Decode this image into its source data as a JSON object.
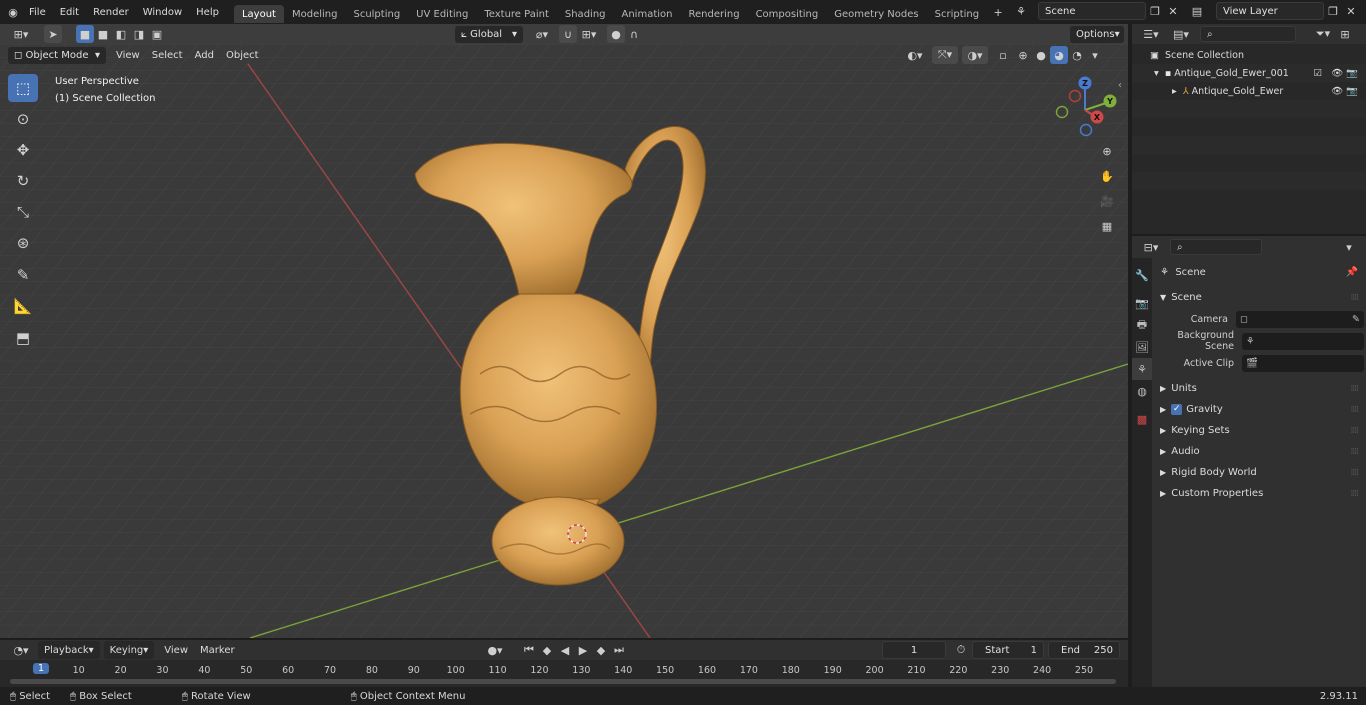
{
  "topbar": {
    "menus": [
      "File",
      "Edit",
      "Render",
      "Window",
      "Help"
    ],
    "workspaces": [
      "Layout",
      "Modeling",
      "Sculpting",
      "UV Editing",
      "Texture Paint",
      "Shading",
      "Animation",
      "Rendering",
      "Compositing",
      "Geometry Nodes",
      "Scripting"
    ],
    "active_workspace": "Layout",
    "add_tab": "+",
    "scene": "Scene",
    "view_layer": "View Layer"
  },
  "viewport_header": {
    "mode": "Object Mode",
    "menus": [
      "View",
      "Select",
      "Add",
      "Object"
    ],
    "transform_orientation": "Global",
    "options": "Options"
  },
  "viewport": {
    "perspective": "User Perspective",
    "collection": "(1) Scene Collection",
    "gizmo_axes": [
      "X",
      "Y",
      "Z"
    ]
  },
  "outliner": {
    "root": "Scene Collection",
    "collection": "Antique_Gold_Ewer_001",
    "object": "Antique_Gold_Ewer"
  },
  "properties": {
    "context": "Scene",
    "panel": "Scene",
    "fields": [
      {
        "label": "Camera",
        "value": ""
      },
      {
        "label": "Background Scene",
        "value": ""
      },
      {
        "label": "Active Clip",
        "value": ""
      }
    ],
    "subpanels": [
      "Units",
      "Gravity",
      "Keying Sets",
      "Audio",
      "Rigid Body World",
      "Custom Properties"
    ]
  },
  "timeline": {
    "menus": [
      "Playback",
      "Keying",
      "View",
      "Marker"
    ],
    "current_frame": "1",
    "start_label": "Start",
    "start": "1",
    "end_label": "End",
    "end": "250",
    "ticks": [
      "1",
      "10",
      "20",
      "30",
      "40",
      "50",
      "60",
      "70",
      "80",
      "90",
      "100",
      "110",
      "120",
      "130",
      "140",
      "150",
      "160",
      "170",
      "180",
      "190",
      "200",
      "210",
      "220",
      "230",
      "240",
      "250"
    ]
  },
  "statusbar": {
    "select": "Select",
    "box_select": "Box Select",
    "rotate": "Rotate View",
    "context_menu": "Object Context Menu",
    "version": "2.93.11"
  },
  "colors": {
    "accent": "#4772b3",
    "grid_x": "#9b3a3a",
    "grid_y": "#6e9a2e",
    "object_gold": "#d9a054"
  }
}
